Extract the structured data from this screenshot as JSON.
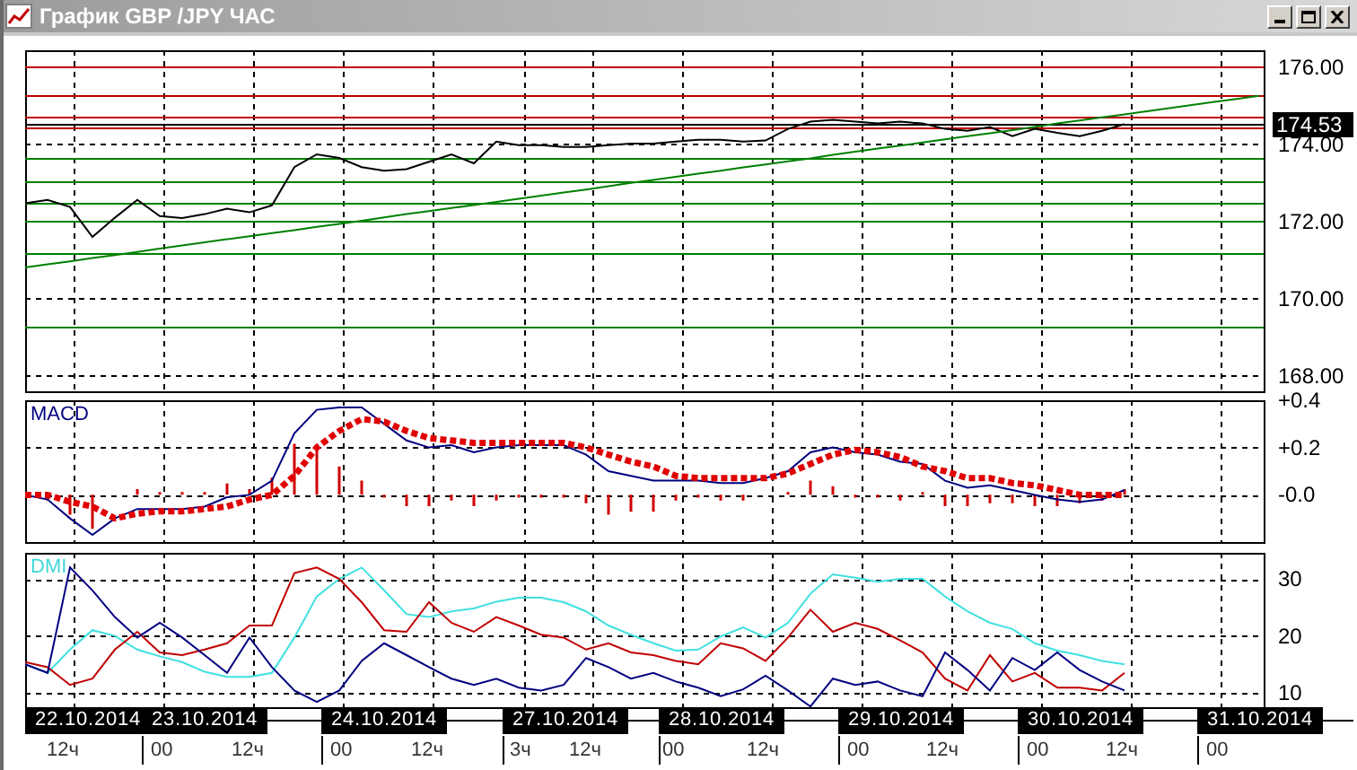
{
  "window": {
    "title": "График GBP /JPY ЧАС"
  },
  "price_chart": {
    "chart_data": {
      "type": "line",
      "ylim": [
        167.6,
        176.44
      ],
      "categories": [
        null,
        null,
        null,
        null,
        null,
        null,
        null,
        null,
        null,
        null,
        null,
        null,
        null,
        null,
        null,
        null,
        null,
        null,
        null,
        null,
        null,
        null,
        null,
        null,
        null,
        null,
        null,
        null,
        null,
        null,
        null,
        null,
        null,
        null,
        null,
        null,
        null,
        null,
        null,
        null,
        null,
        null,
        null,
        null,
        null,
        null,
        null,
        null,
        null,
        null,
        null,
        null,
        null,
        null,
        null,
        null
      ],
      "series": [
        {
          "color": "#000000",
          "values": [
            172.47,
            172.56,
            172.38,
            171.6,
            172.1,
            172.56,
            172.14,
            172.09,
            172.19,
            172.33,
            172.24,
            172.42,
            173.41,
            173.74,
            173.65,
            173.41,
            173.32,
            173.36,
            173.55,
            173.74,
            173.51,
            174.07,
            173.98,
            173.98,
            173.93,
            173.93,
            173.98,
            174.02,
            174.02,
            174.07,
            174.12,
            174.12,
            174.07,
            174.1,
            174.4,
            174.59,
            174.64,
            174.59,
            174.54,
            174.59,
            174.54,
            174.4,
            174.35,
            174.45,
            174.21,
            174.4,
            174.3,
            174.21,
            174.35,
            174.53,
            null,
            null,
            null,
            null,
            null,
            null
          ]
        },
        {
          "color": "#008000",
          "values": [
            170.81,
            170.89,
            170.97,
            171.05,
            171.13,
            171.21,
            171.3,
            171.38,
            171.46,
            171.54,
            171.62,
            171.7,
            171.78,
            171.86,
            171.94,
            172.02,
            172.11,
            172.19,
            172.27,
            172.35,
            172.43,
            172.51,
            172.59,
            172.67,
            172.75,
            172.83,
            172.92,
            173.0,
            173.08,
            173.16,
            173.24,
            173.32,
            173.4,
            173.48,
            173.56,
            173.64,
            173.73,
            173.81,
            173.89,
            173.97,
            174.05,
            174.13,
            174.21,
            174.29,
            174.37,
            174.45,
            174.54,
            174.62,
            174.7,
            174.78,
            174.86,
            174.94,
            175.02,
            175.1,
            175.18,
            175.26
          ]
        }
      ],
      "yticks": [
        {
          "value": 176,
          "label": "176.00"
        },
        {
          "value": 174,
          "label": "174.00"
        },
        {
          "value": 172,
          "label": "172.00"
        },
        {
          "value": 170,
          "label": "170.00"
        },
        {
          "value": 168,
          "label": "168.00"
        }
      ],
      "grid": true,
      "ref_lines": [
        {
          "axis": "y",
          "value": 176.02,
          "color": "#c00000"
        },
        {
          "axis": "y",
          "value": 175.28,
          "color": "#c00000"
        },
        {
          "axis": "y",
          "value": 174.72,
          "color": "#c00000"
        },
        {
          "axis": "y",
          "value": 174.42,
          "color": "#c00000"
        },
        {
          "axis": "y",
          "value": 173.65,
          "color": "#008000"
        },
        {
          "axis": "y",
          "value": 173.05,
          "color": "#008000"
        },
        {
          "axis": "y",
          "value": 172.49,
          "color": "#008000"
        },
        {
          "axis": "y",
          "value": 172.02,
          "color": "#008000"
        },
        {
          "axis": "y",
          "value": 171.19,
          "color": "#008000"
        },
        {
          "axis": "y",
          "value": 169.28,
          "color": "#008000"
        },
        {
          "axis": "y",
          "value": 174.53,
          "color": "#000000",
          "label": "174.53"
        }
      ]
    }
  },
  "macd_chart": {
    "chart_data": {
      "type": "line",
      "title": "MACD",
      "ylim": [
        -0.2,
        0.4
      ],
      "categories": [
        null,
        null,
        null,
        null,
        null,
        null,
        null,
        null,
        null,
        null,
        null,
        null,
        null,
        null,
        null,
        null,
        null,
        null,
        null,
        null,
        null,
        null,
        null,
        null,
        null,
        null,
        null,
        null,
        null,
        null,
        null,
        null,
        null,
        null,
        null,
        null,
        null,
        null,
        null,
        null,
        null,
        null,
        null,
        null,
        null,
        null,
        null,
        null,
        null,
        null
      ],
      "series": [
        {
          "color": "#000080",
          "values": [
            0,
            -0.02,
            -0.1,
            -0.17,
            -0.1,
            -0.06,
            -0.06,
            -0.06,
            -0.05,
            -0.01,
            0,
            0.06,
            0.26,
            0.36,
            0.37,
            0.37,
            0.3,
            0.23,
            0.2,
            0.21,
            0.18,
            0.2,
            0.21,
            0.21,
            0.21,
            0.17,
            0.1,
            0.08,
            0.06,
            0.06,
            0.06,
            0.05,
            0.05,
            0.07,
            0.1,
            0.18,
            0.2,
            0.18,
            0.17,
            0.14,
            0.13,
            0.06,
            0.03,
            0.04,
            0.02,
            0,
            -0.02,
            -0.03,
            -0.02,
            0.02
          ]
        },
        {
          "color": "#e00000",
          "line_style": "dotted",
          "values": [
            0,
            0,
            -0.03,
            -0.05,
            -0.1,
            -0.08,
            -0.07,
            -0.07,
            -0.06,
            -0.05,
            -0.02,
            0,
            0.08,
            0.2,
            0.27,
            0.32,
            0.31,
            0.27,
            0.24,
            0.23,
            0.22,
            0.22,
            0.22,
            0.22,
            0.22,
            0.2,
            0.17,
            0.14,
            0.12,
            0.08,
            0.07,
            0.07,
            0.07,
            0.07,
            0.09,
            0.13,
            0.17,
            0.19,
            0.18,
            0.16,
            0.12,
            0.1,
            0.07,
            0.07,
            0.05,
            0.04,
            0.02,
            0,
            0,
            0
          ]
        }
      ],
      "yticks": [
        {
          "value": 0.4,
          "label": "+0.4"
        },
        {
          "value": 0.2,
          "label": "+0.2"
        },
        {
          "value": 0,
          "label": "-0.0"
        }
      ],
      "grid": true
    }
  },
  "dmi_chart": {
    "chart_data": {
      "type": "line",
      "title": "DMI",
      "ylim": [
        7.48,
        34.57
      ],
      "categories": [
        null,
        null,
        null,
        null,
        null,
        null,
        null,
        null,
        null,
        null,
        null,
        null,
        null,
        null,
        null,
        null,
        null,
        null,
        null,
        null,
        null,
        null,
        null,
        null,
        null,
        null,
        null,
        null,
        null,
        null,
        null,
        null,
        null,
        null,
        null,
        null,
        null,
        null,
        null,
        null,
        null,
        null,
        null,
        null,
        null,
        null,
        null,
        null,
        null,
        null
      ],
      "series": [
        {
          "color": "#40e0e0",
          "values": [
            15,
            13.5,
            17.6,
            21,
            20,
            17.6,
            16.4,
            15.4,
            13.7,
            12.8,
            12.8,
            13.5,
            19.7,
            26.9,
            30,
            32,
            28,
            23.8,
            23.3,
            24.3,
            24.8,
            26,
            26.7,
            26.7,
            25.9,
            24.3,
            21.8,
            20.2,
            18.7,
            17.4,
            17.6,
            19.9,
            21.5,
            19.7,
            22.3,
            27.4,
            30.8,
            30.2,
            29.5,
            30,
            30,
            26.9,
            24.3,
            22.3,
            21.2,
            18.7,
            17.4,
            16.6,
            15.6,
            15
          ]
        },
        {
          "color": "#c00000",
          "values": [
            15.4,
            14.5,
            11.4,
            12.5,
            17.6,
            20.7,
            17.1,
            16.6,
            17.6,
            18.7,
            21.8,
            21.8,
            31,
            32,
            30,
            25.9,
            21,
            20.7,
            25.9,
            22.3,
            20.7,
            23.3,
            21.8,
            20.2,
            19.7,
            17.6,
            18.7,
            17.1,
            16.6,
            15.6,
            15,
            18.7,
            17.8,
            15.6,
            19.7,
            24.6,
            20.7,
            22.3,
            21.2,
            19.2,
            17.1,
            12.5,
            10.4,
            16.6,
            12,
            13.5,
            10.9,
            10.9,
            10.4,
            13.5
          ]
        },
        {
          "color": "#000080",
          "values": [
            15,
            13.5,
            32,
            28,
            23.3,
            19.7,
            22.3,
            19.7,
            16.6,
            13.5,
            19.7,
            14.5,
            10.4,
            8.4,
            10.4,
            15.6,
            18.7,
            16.6,
            14.5,
            12.5,
            11.4,
            12.5,
            10.9,
            10.4,
            11.4,
            16.1,
            14.5,
            12.5,
            13.5,
            12,
            10.9,
            9.4,
            10.6,
            13,
            10.4,
            7.6,
            12.5,
            11.4,
            12,
            10.4,
            9.4,
            17.1,
            14,
            10.4,
            16.1,
            14,
            17.1,
            14,
            12,
            10.4
          ]
        }
      ],
      "yticks": [
        {
          "value": 30,
          "label": "30"
        },
        {
          "value": 20,
          "label": "20"
        },
        {
          "value": 10,
          "label": "10"
        }
      ],
      "grid": true
    }
  },
  "time_axis": {
    "dates": [
      "22.10.2014",
      "23.10.2014",
      "24.10.2014",
      "27.10.2014",
      "28.10.2014",
      "29.10.2014",
      "30.10.2014",
      "31.10.2014"
    ],
    "hours": [
      "12ч",
      "00",
      "12ч",
      "00",
      "12ч",
      "3ч",
      "12ч",
      "00",
      "12ч",
      "00",
      "12ч",
      "00",
      "12ч",
      "00"
    ]
  }
}
